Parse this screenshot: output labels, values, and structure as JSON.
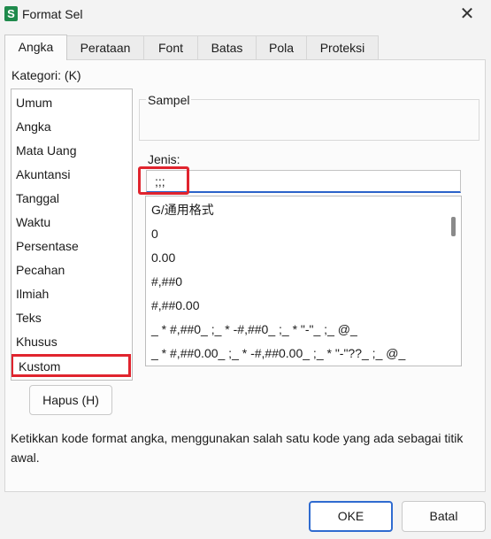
{
  "window": {
    "title": "Format Sel",
    "app_icon_letter": "S",
    "close_glyph": "✕"
  },
  "tabs": [
    {
      "label": "Angka"
    },
    {
      "label": "Perataan"
    },
    {
      "label": "Font"
    },
    {
      "label": "Batas"
    },
    {
      "label": "Pola"
    },
    {
      "label": "Proteksi"
    }
  ],
  "active_tab": "Angka",
  "kategori": {
    "label": "Kategori: (K)",
    "items": [
      "Umum",
      "Angka",
      "Mata Uang",
      "Akuntansi",
      "Tanggal",
      "Waktu",
      "Persentase",
      "Pecahan",
      "Ilmiah",
      "Teks",
      "Khusus",
      "Kustom"
    ],
    "selected": "Kustom"
  },
  "sampel": {
    "label": "Sampel",
    "value": ""
  },
  "jenis": {
    "label": "Jenis:",
    "value": ";;;",
    "options": [
      "G/通用格式",
      "0",
      "0.00",
      "#,##0",
      "#,##0.00",
      "_ * #,##0_ ;_ * -#,##0_ ;_ * \"-\"_ ;_ @_",
      "_ * #,##0.00_ ;_ * -#,##0.00_ ;_ * \"-\"??_ ;_ @_"
    ]
  },
  "buttons": {
    "hapus": "Hapus (H)",
    "ok": "OKE",
    "batal": "Batal"
  },
  "description": "Ketikkan kode format angka, menggunakan salah satu kode yang ada sebagai titik awal.",
  "colors": {
    "highlight": "#e0242e",
    "accent": "#2f6bd0",
    "app_icon": "#1f8a4c"
  }
}
